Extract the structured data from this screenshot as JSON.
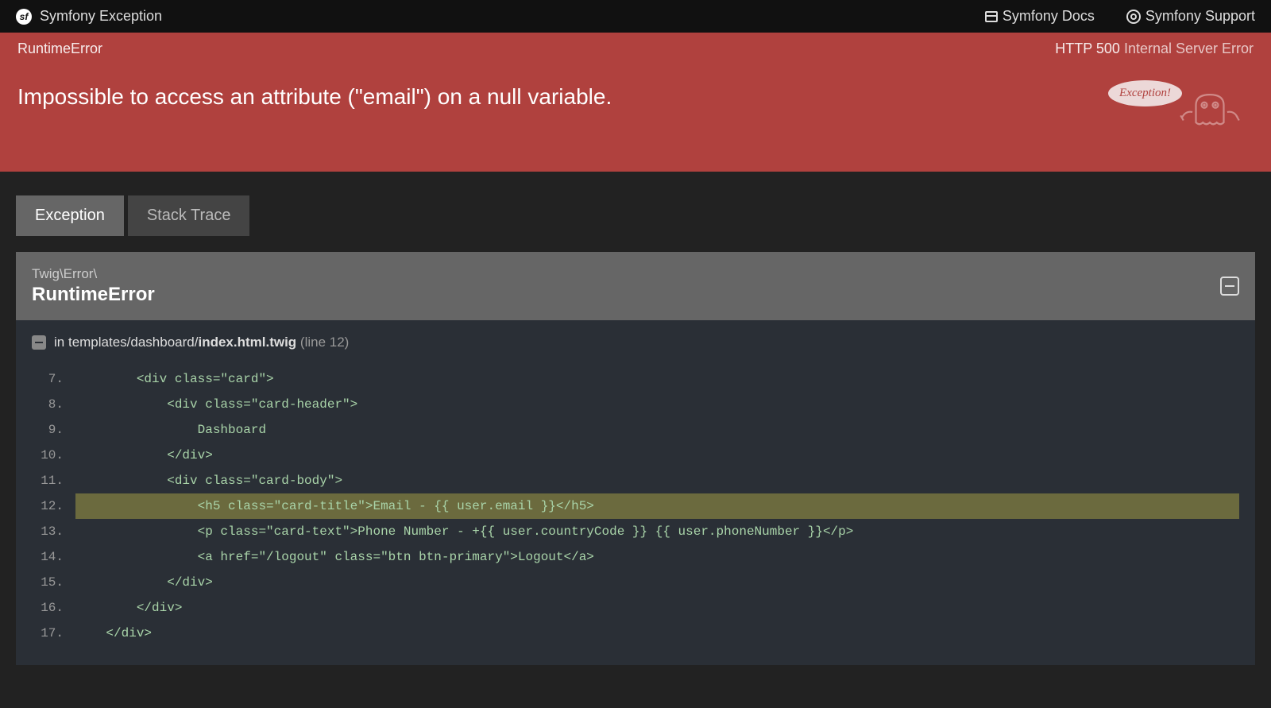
{
  "topBar": {
    "title": "Symfony Exception",
    "docsLabel": "Symfony Docs",
    "supportLabel": "Symfony Support"
  },
  "error": {
    "type": "RuntimeError",
    "httpCode": "HTTP 500",
    "httpText": "Internal Server Error",
    "message": "Impossible to access an attribute (\"email\") on a null variable.",
    "bubbleText": "Exception!"
  },
  "tabs": {
    "exception": "Exception",
    "stackTrace": "Stack Trace"
  },
  "exception": {
    "namespace": "Twig\\Error\\",
    "className": "RuntimeError",
    "locationPrefix": "in ",
    "locationPath": "templates/dashboard/",
    "locationFile": "index.html.twig",
    "locationLine": " (line 12)"
  },
  "code": {
    "lines": [
      {
        "num": "7.",
        "content": "        <div class=\"card\">",
        "highlighted": false
      },
      {
        "num": "8.",
        "content": "            <div class=\"card-header\">",
        "highlighted": false
      },
      {
        "num": "9.",
        "content": "                Dashboard",
        "highlighted": false
      },
      {
        "num": "10.",
        "content": "            </div>",
        "highlighted": false
      },
      {
        "num": "11.",
        "content": "            <div class=\"card-body\">",
        "highlighted": false
      },
      {
        "num": "12.",
        "content": "                <h5 class=\"card-title\">Email - {{ user.email }}</h5>",
        "highlighted": true
      },
      {
        "num": "13.",
        "content": "                <p class=\"card-text\">Phone Number - +{{ user.countryCode }} {{ user.phoneNumber }}</p>",
        "highlighted": false
      },
      {
        "num": "14.",
        "content": "                <a href=\"/logout\" class=\"btn btn-primary\">Logout</a>",
        "highlighted": false
      },
      {
        "num": "15.",
        "content": "            </div>",
        "highlighted": false
      },
      {
        "num": "16.",
        "content": "        </div>",
        "highlighted": false
      },
      {
        "num": "17.",
        "content": "    </div>",
        "highlighted": false
      }
    ]
  }
}
